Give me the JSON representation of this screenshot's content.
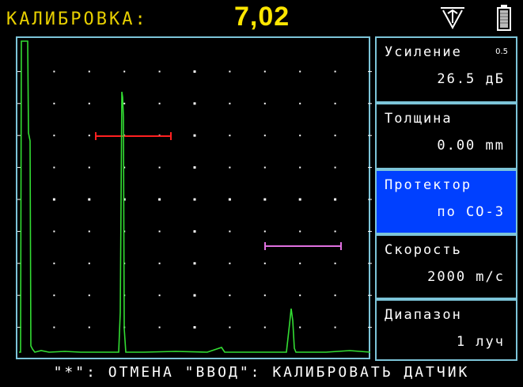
{
  "header": {
    "title": "КАЛИБРОВКА:",
    "value": "7,02",
    "icons": [
      "probe-trigger-icon",
      "battery-icon"
    ]
  },
  "menu": {
    "items": [
      {
        "label": "Усиление",
        "value": "26.5 дБ",
        "superscript": "0.5",
        "selected": false
      },
      {
        "label": "Толщина",
        "value": "0.00 mm",
        "selected": false
      },
      {
        "label": "Протектор",
        "value": "по СО-3",
        "selected": true
      },
      {
        "label": "Скорость",
        "value": "2000 m/c",
        "selected": false
      },
      {
        "label": "Диапазон",
        "value": "1 луч",
        "selected": false
      }
    ]
  },
  "status": {
    "hint": "\"*\": ОТМЕНА \"ВВОД\": КАЛИБРОВАТЬ ДАТЧИК"
  },
  "colors": {
    "title": "#e8d000",
    "value": "#ffe600",
    "border": "#7cc4d8",
    "trace": "#33dd33",
    "gate_a": "#ff2020",
    "gate_b": "#e070e0",
    "selected_bg": "#0040ff"
  }
}
